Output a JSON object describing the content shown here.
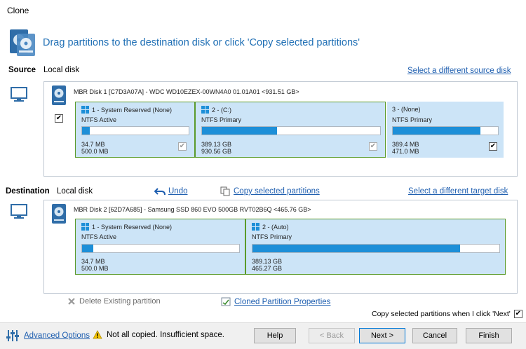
{
  "window": {
    "title": "Clone"
  },
  "header": {
    "text": "Drag partitions to the destination disk or click 'Copy selected partitions'"
  },
  "source": {
    "label": "Source",
    "disk_type": "Local disk",
    "select_link": "Select a different source disk",
    "disk_header": "MBR Disk 1 [C7D3A07A] - WDC WD10EZEX-00WN4A0 01.01A01  <931.51 GB>",
    "partitions": [
      {
        "title": "1 - System Reserved (None)",
        "fs": "NTFS Active",
        "used": "34.7 MB",
        "total": "500.0 MB",
        "fill": 0.07
      },
      {
        "title": "2 -  (C:)",
        "fs": "NTFS Primary",
        "used": "389.13 GB",
        "total": "930.56 GB",
        "fill": 0.42
      },
      {
        "title": "3 -  (None)",
        "fs": "NTFS Primary",
        "used": "389.4 MB",
        "total": "471.0 MB",
        "fill": 0.83
      }
    ]
  },
  "destination": {
    "label": "Destination",
    "disk_type": "Local disk",
    "undo_link": "Undo",
    "copy_link": "Copy selected partitions",
    "select_link": "Select a different target disk",
    "disk_header": "MBR Disk 2 [62D7A685] - Samsung SSD 860 EVO 500GB RVT02B6Q  <465.76 GB>",
    "partitions": [
      {
        "title": "1 - System Reserved (None)",
        "fs": "NTFS Active",
        "used": "34.7 MB",
        "total": "500.0 MB",
        "fill": 0.07
      },
      {
        "title": "2 -  (Auto)",
        "fs": "NTFS Primary",
        "used": "389.13 GB",
        "total": "465.27 GB",
        "fill": 0.84
      }
    ]
  },
  "actions": {
    "delete_partition": "Delete Existing partition",
    "cloned_properties": "Cloned Partition Properties",
    "copy_on_next": "Copy selected partitions when I click 'Next'"
  },
  "footer": {
    "advanced_options": "Advanced Options",
    "warning": "Not all copied. Insufficient space.",
    "help": "Help",
    "back": "< Back",
    "next": "Next >",
    "cancel": "Cancel",
    "finish": "Finish"
  }
}
